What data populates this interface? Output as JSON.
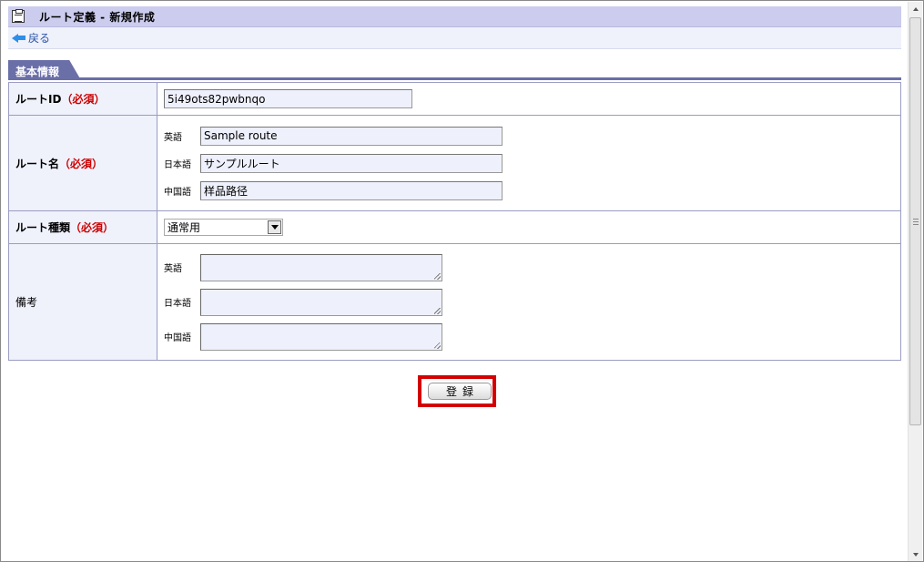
{
  "header": {
    "title": "ルート定義 - 新規作成",
    "icon": "clipboard-icon"
  },
  "nav": {
    "back_label": "戻る",
    "back_icon": "back-arrow-icon"
  },
  "section_tab": {
    "label": "基本情報"
  },
  "form": {
    "route_id": {
      "label": "ルートID",
      "required_label": "（必須）",
      "value": "5i49ots82pwbnqo"
    },
    "route_name": {
      "label": "ルート名",
      "required_label": "（必須）",
      "languages": [
        {
          "lang": "英語",
          "value": "Sample route"
        },
        {
          "lang": "日本語",
          "value": "サンプルルート"
        },
        {
          "lang": "中国語",
          "value": "样品路径"
        }
      ]
    },
    "route_type": {
      "label": "ルート種類",
      "required_label": "（必須）",
      "selected": "通常用"
    },
    "remarks": {
      "label": "備考",
      "languages": [
        {
          "lang": "英語",
          "value": ""
        },
        {
          "lang": "日本語",
          "value": ""
        },
        {
          "lang": "中国語",
          "value": ""
        }
      ]
    }
  },
  "actions": {
    "register_label": "登録"
  },
  "colors": {
    "title_bar": "#ccccee",
    "tab": "#6a6fa8",
    "label_bg": "#eff1fb",
    "required": "#cc0000",
    "highlight": "#d40000"
  }
}
